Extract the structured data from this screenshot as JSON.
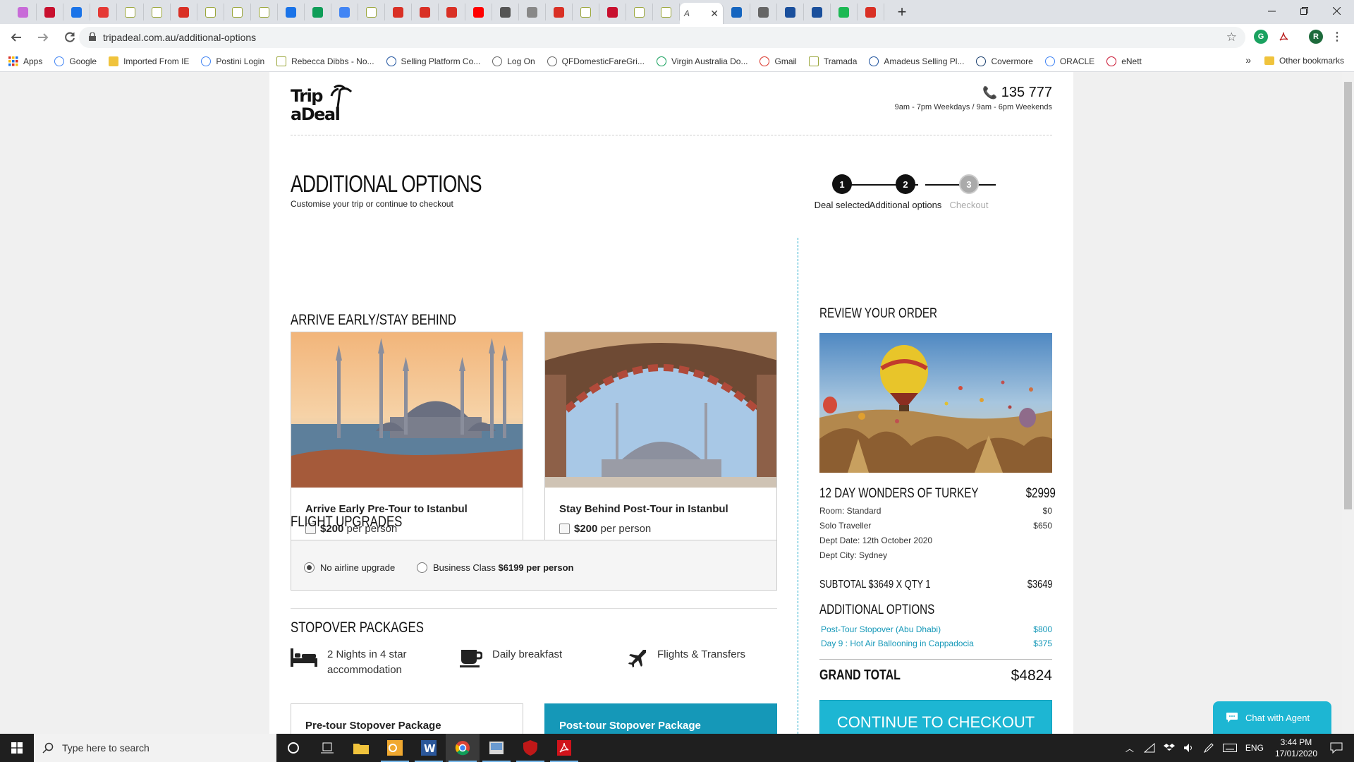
{
  "browser": {
    "url": "tripadeal.com.au/additional-options",
    "active_tab_label": "A",
    "new_tab_glyph": "+",
    "close_glyph": "✕",
    "profile_initial": "R",
    "extension_letter": "G"
  },
  "bookmarks": [
    {
      "label": "Apps",
      "icon": "apps-grid-icon"
    },
    {
      "label": "Google",
      "icon": "google-icon"
    },
    {
      "label": "Imported From IE",
      "icon": "folder-icon"
    },
    {
      "label": "Postini Login",
      "icon": "google-icon"
    },
    {
      "label": "Rebecca Dibbs - No...",
      "icon": "doc-icon"
    },
    {
      "label": "Selling Platform Co...",
      "icon": "amadeus-icon"
    },
    {
      "label": "Log On",
      "icon": "globe-icon"
    },
    {
      "label": "QFDomesticFareGri...",
      "icon": "globe-icon"
    },
    {
      "label": "Virgin Australia Do...",
      "icon": "drive-icon"
    },
    {
      "label": "Gmail",
      "icon": "gmail-icon"
    },
    {
      "label": "Tramada",
      "icon": "doc-icon"
    },
    {
      "label": "Amadeus Selling Pl...",
      "icon": "amadeus-icon"
    },
    {
      "label": "Covermore",
      "icon": "covermore-icon"
    },
    {
      "label": "ORACLE",
      "icon": "google-icon"
    },
    {
      "label": "eNett",
      "icon": "enett-icon"
    }
  ],
  "bookmarks_more": "»",
  "bookmarks_other": "Other bookmarks",
  "header": {
    "phone": "135 777",
    "hours": "9am - 7pm Weekdays / 9am - 6pm Weekends",
    "logo_line1": "Trip",
    "logo_line2": "aDeal"
  },
  "title": "ADDITIONAL OPTIONS",
  "subtitle": "Customise your trip or continue to checkout",
  "steps": [
    {
      "num": "1",
      "label": "Deal selected",
      "state": "done"
    },
    {
      "num": "2",
      "label": "Additional options",
      "state": "current"
    },
    {
      "num": "3",
      "label": "Checkout",
      "state": "todo"
    }
  ],
  "arrive": {
    "heading": "ARRIVE EARLY/STAY BEHIND",
    "options": [
      {
        "title": "Arrive Early Pre-Tour to Istanbul",
        "price": "$200",
        "unit": "per person"
      },
      {
        "title": "Stay Behind Post-Tour in Istanbul",
        "price": "$200",
        "unit": "per person"
      }
    ]
  },
  "flights": {
    "heading": "FLIGHT UPGRADES",
    "none_label": "No airline upgrade",
    "business_label": "Business Class",
    "business_price": "$6199 per person"
  },
  "stopover": {
    "heading": "STOPOVER PACKAGES",
    "features": [
      {
        "line1": "2 Nights in 4 star",
        "line2": "accommodation",
        "icon": "bed-icon"
      },
      {
        "line1": "Daily breakfast",
        "line2": "",
        "icon": "coffee-cup-icon"
      },
      {
        "line1": "Flights & Transfers",
        "line2": "",
        "icon": "airplane-icon"
      }
    ],
    "packages": [
      "Pre-tour Stopover Package",
      "Post-tour Stopover Package"
    ]
  },
  "order": {
    "heading": "REVIEW YOUR ORDER",
    "trip_name": "12 DAY WONDERS OF TURKEY",
    "trip_price": "$2999",
    "room_label": "Room: Standard",
    "room_price": "$0",
    "solo_label": "Solo Traveller",
    "solo_price": "$650",
    "dept_date": "Dept Date: 12th October 2020",
    "dept_city": "Dept City: Sydney",
    "subtotal_label": "SUBTOTAL $3649 X QTY 1",
    "subtotal": "$3649",
    "addons_heading": "ADDITIONAL OPTIONS",
    "addons": [
      {
        "label": "Post-Tour Stopover (Abu Dhabi)",
        "price": "$800"
      },
      {
        "label": "Day 9 : Hot Air Ballooning in Cappadocia",
        "price": "$375"
      }
    ],
    "grand_label": "GRAND TOTAL",
    "grand_total": "$4824",
    "checkout_label": "CONTINUE TO CHECKOUT"
  },
  "chat_label": "Chat with Agent",
  "taskbar": {
    "search_placeholder": "Type here to search",
    "lang": "ENG",
    "time": "3:44 PM",
    "date": "17/01/2020"
  },
  "colors": {
    "accent": "#1db6d3",
    "addon": "#1598b8",
    "dark": "#111111",
    "step_todo": "#aaaaaa"
  }
}
